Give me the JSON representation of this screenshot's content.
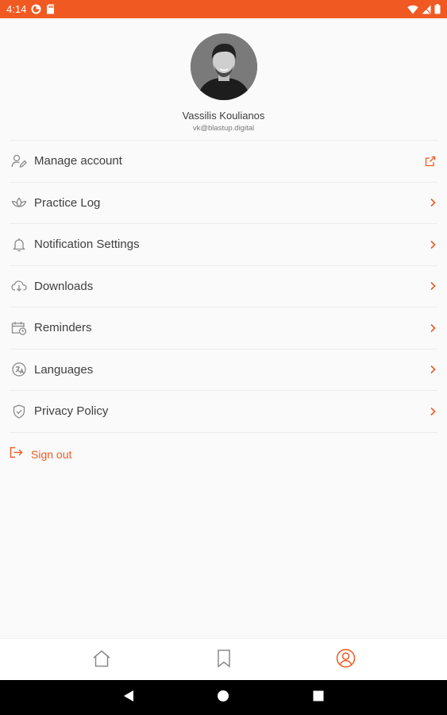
{
  "status_bar": {
    "time": "4:14",
    "color": "#f05a22"
  },
  "profile": {
    "name": "Vassilis Koulianos",
    "email": "vk@blastup.digital",
    "avatar_icon": "person-photo"
  },
  "menu": {
    "items": [
      {
        "label": "Manage account",
        "icon": "user-edit-icon",
        "trailing": "external-link-icon"
      },
      {
        "label": "Practice Log",
        "icon": "lotus-icon",
        "trailing": "chevron-right-icon"
      },
      {
        "label": "Notification Settings",
        "icon": "bell-icon",
        "trailing": "chevron-right-icon"
      },
      {
        "label": "Downloads",
        "icon": "cloud-download-icon",
        "trailing": "chevron-right-icon"
      },
      {
        "label": "Reminders",
        "icon": "calendar-clock-icon",
        "trailing": "chevron-right-icon"
      },
      {
        "label": "Languages",
        "icon": "language-icon",
        "trailing": "chevron-right-icon"
      },
      {
        "label": "Privacy Policy",
        "icon": "shield-check-icon",
        "trailing": "chevron-right-icon"
      }
    ]
  },
  "sign_out": {
    "label": "Sign out",
    "color": "#f05a22"
  },
  "bottom_nav": {
    "items": [
      {
        "icon": "home-icon",
        "active": false
      },
      {
        "icon": "bookmark-icon",
        "active": false
      },
      {
        "icon": "profile-icon",
        "active": true
      }
    ]
  },
  "accent_color": "#f05a22"
}
